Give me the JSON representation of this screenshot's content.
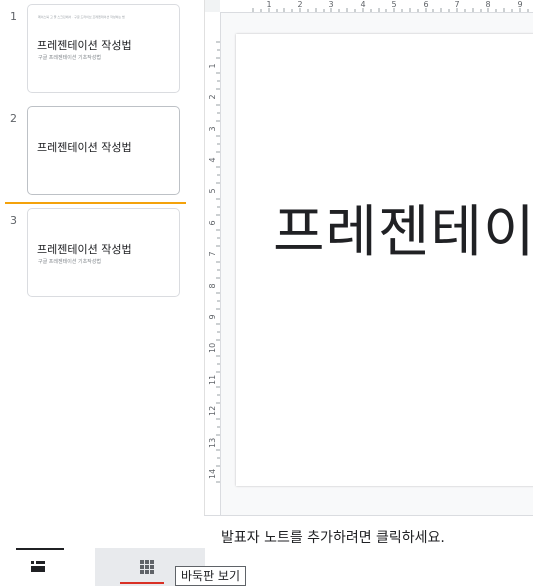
{
  "filmstrip": {
    "slides": [
      {
        "number": "1",
        "tiny_text": "페이스북 고 풀 스크린에서 · 구글 드라이브 프레젠테이션 작성하는 법",
        "title": "프레젠테이션 작성법",
        "subtitle": "구글 프레젠테이션 기초작성법"
      },
      {
        "number": "2",
        "title": "프레젠테이션 작성법"
      },
      {
        "number": "3",
        "title": "프레젠테이션 작성법",
        "subtitle": "구글 프레젠테이션 기초작성법"
      }
    ],
    "drop_indicator_color": "#f4a20b"
  },
  "view_toggle": {
    "filmstrip_icon": "filmstrip-view-icon",
    "grid_icon": "grid-view-icon",
    "tooltip": "바둑판 보기"
  },
  "rulers": {
    "horizontal": [
      "1",
      "2",
      "3",
      "4",
      "5",
      "6",
      "7",
      "8",
      "9"
    ],
    "vertical": [
      "1",
      "2",
      "3",
      "4",
      "5",
      "6",
      "7",
      "8",
      "9",
      "10",
      "11",
      "12",
      "13",
      "14"
    ]
  },
  "canvas": {
    "title": "프레젠테이션"
  },
  "notes": {
    "placeholder": "발표자 노트를 추가하려면 클릭하세요."
  }
}
